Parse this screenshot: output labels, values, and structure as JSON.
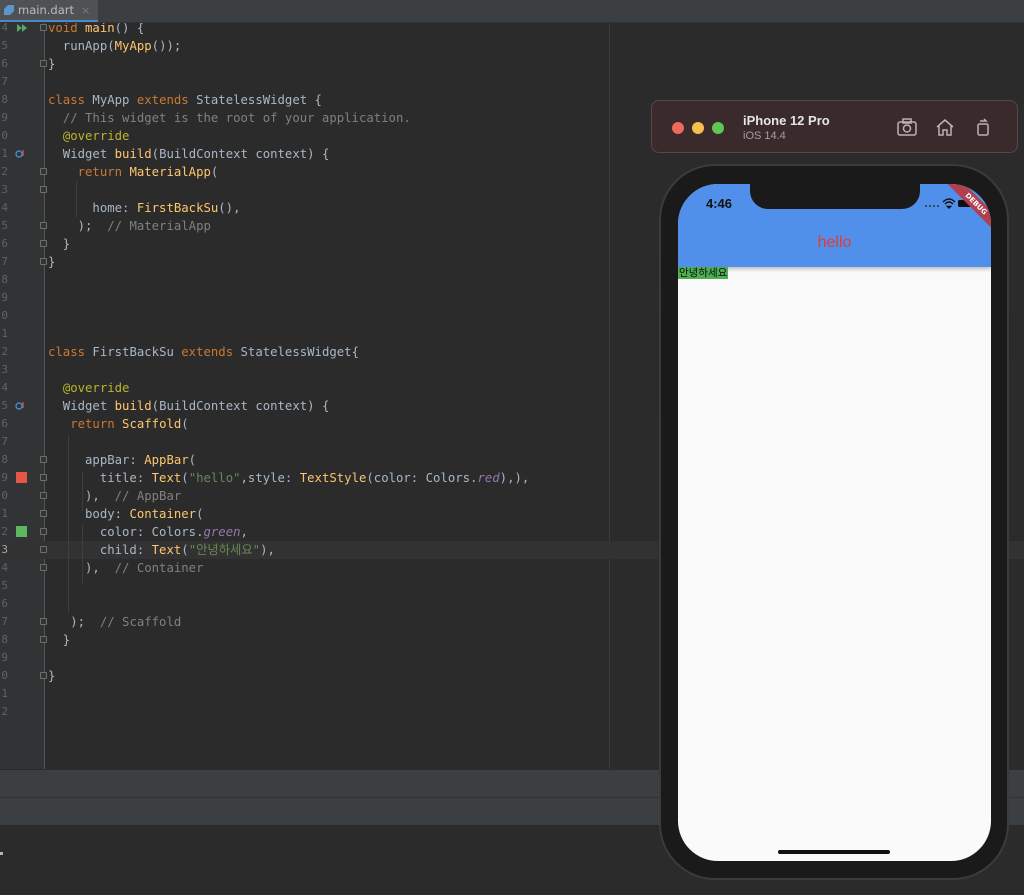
{
  "tab": {
    "label": "main.dart",
    "close": "×"
  },
  "editor": {
    "lines": [
      {
        "n": "4",
        "html": "<span class='kw'>void</span> <span class='fn'>main</span>() {"
      },
      {
        "n": "5",
        "html": "  runApp(<span class='fn'>MyApp</span>());"
      },
      {
        "n": "6",
        "html": "}"
      },
      {
        "n": "7",
        "html": ""
      },
      {
        "n": "8",
        "html": "<span class='kw'>class</span> MyApp <span class='kw'>extends</span> StatelessWidget {"
      },
      {
        "n": "9",
        "html": "  <span class='cm'>// This widget is the root of your application.</span>"
      },
      {
        "n": "0",
        "html": "  <span class='ann'>@override</span>"
      },
      {
        "n": "1",
        "html": "  Widget <span class='fn'>build</span>(BuildContext context) {"
      },
      {
        "n": "2",
        "html": "    <span class='kw'>return</span> <span class='fn'>MaterialApp</span>("
      },
      {
        "n": "3",
        "html": ""
      },
      {
        "n": "4",
        "html": "      home: <span class='fn'>FirstBackSu</span>(),"
      },
      {
        "n": "5",
        "html": "    );  <span class='cm'>// MaterialApp</span>"
      },
      {
        "n": "6",
        "html": "  }"
      },
      {
        "n": "7",
        "html": "}"
      },
      {
        "n": "8",
        "html": ""
      },
      {
        "n": "9",
        "html": ""
      },
      {
        "n": "0",
        "html": ""
      },
      {
        "n": "1",
        "html": ""
      },
      {
        "n": "2",
        "html": "<span class='kw'>class</span> FirstBackSu <span class='kw'>extends</span> StatelessWidget{"
      },
      {
        "n": "3",
        "html": ""
      },
      {
        "n": "4",
        "html": "  <span class='ann'>@override</span>"
      },
      {
        "n": "5",
        "html": "  Widget <span class='fn'>build</span>(BuildContext context) {"
      },
      {
        "n": "6",
        "html": "   <span class='kw'>return</span> <span class='fn'>Scaffold</span>("
      },
      {
        "n": "7",
        "html": ""
      },
      {
        "n": "8",
        "html": "     appBar: <span class='fn'>AppBar</span>("
      },
      {
        "n": "9",
        "html": "       title: <span class='fn'>Text</span>(<span class='str'>\"hello\"</span>,style: <span class='fn'>TextStyle</span>(color: Colors.<span class='it'>red</span>),),"
      },
      {
        "n": "0",
        "html": "     ),  <span class='cm'>// AppBar</span>"
      },
      {
        "n": "1",
        "html": "     body: <span class='fn'>Container</span>("
      },
      {
        "n": "2",
        "html": "       color: Colors.<span class='it'>green</span>,"
      },
      {
        "n": "3",
        "html": "       child: <span class='fn'>Text</span>(<span class='str'>\"안녕하세요\"</span>),"
      },
      {
        "n": "4",
        "html": "     ),  <span class='cm'>// Container</span>"
      },
      {
        "n": "5",
        "html": ""
      },
      {
        "n": "6",
        "html": ""
      },
      {
        "n": "7",
        "html": "   );  <span class='cm'>// Scaffold</span>"
      },
      {
        "n": "8",
        "html": "  }"
      },
      {
        "n": "9",
        "html": ""
      },
      {
        "n": "0",
        "html": "}"
      },
      {
        "n": "1",
        "html": ""
      },
      {
        "n": "2",
        "html": ""
      }
    ],
    "current_line_number": "3",
    "swatch_red": "#e25747",
    "swatch_green": "#5cb85c"
  },
  "simulator": {
    "device": "iPhone 12 Pro",
    "os": "iOS 14.4",
    "icons": [
      "screenshot-icon",
      "home-icon",
      "rotate-icon"
    ],
    "status_time": "4:46",
    "debug_banner": "DEBUG",
    "app": {
      "title": "hello",
      "title_color": "#e53935",
      "appbar_color": "#5090ea",
      "body_text": "안녕하세요",
      "body_color": "#4caf50"
    }
  }
}
